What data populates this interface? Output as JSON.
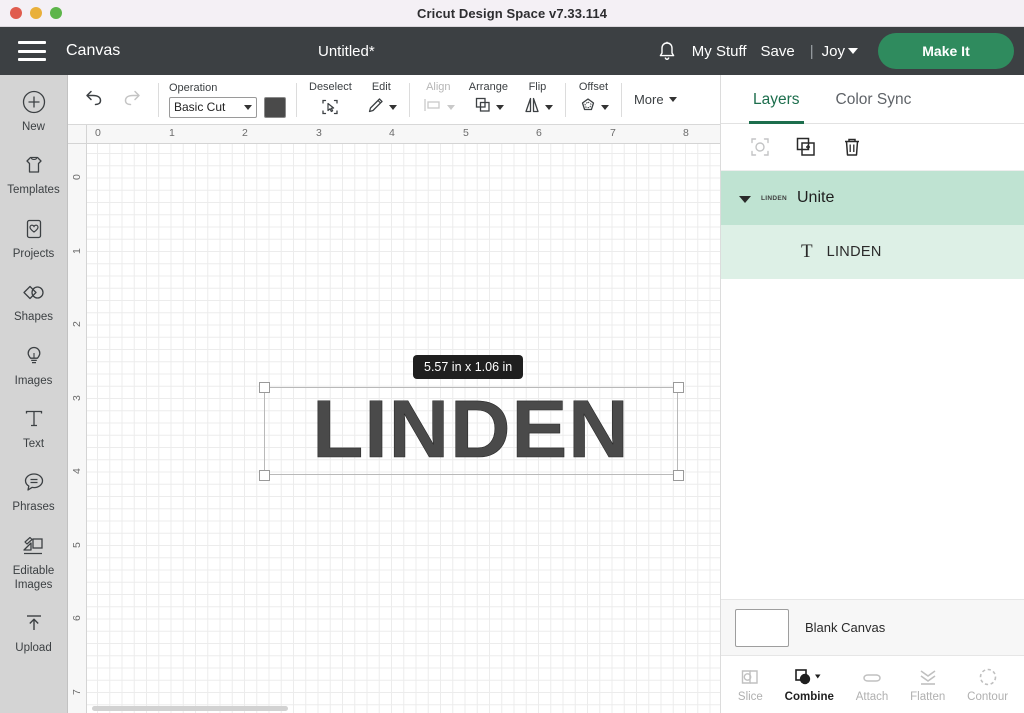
{
  "window": {
    "title": "Cricut Design Space  v7.33.114",
    "traffic_lights": [
      "close",
      "minimize",
      "maximize"
    ]
  },
  "header": {
    "menu_icon": "hamburger-icon",
    "canvas_label": "Canvas",
    "document_title": "Untitled*",
    "bell_icon": "bell-icon",
    "my_stuff": "My Stuff",
    "save": "Save",
    "divider": "|",
    "machine": "Joy",
    "make_it": "Make It",
    "make_it_color": "#2f8b5e"
  },
  "sidebar": {
    "items": [
      {
        "label": "New",
        "icon": "plus-circle-icon"
      },
      {
        "label": "Templates",
        "icon": "tshirt-icon"
      },
      {
        "label": "Projects",
        "icon": "heart-card-icon"
      },
      {
        "label": "Shapes",
        "icon": "shapes-icon"
      },
      {
        "label": "Images",
        "icon": "lightbulb-icon"
      },
      {
        "label": "Text",
        "icon": "text-t-icon"
      },
      {
        "label": "Phrases",
        "icon": "speech-bubble-icon"
      },
      {
        "label": "Editable Images",
        "icon": "editable-images-icon"
      },
      {
        "label": "Upload",
        "icon": "upload-arrow-icon"
      }
    ]
  },
  "toolbar": {
    "undo_icon": "undo-icon",
    "redo_icon": "redo-icon",
    "operation_label": "Operation",
    "operation_value": "Basic Cut",
    "operation_color": "#4a4a4a",
    "groups": [
      {
        "caption": "Deselect",
        "icon": "deselect-icon",
        "disabled": false,
        "has_caret": false
      },
      {
        "caption": "Edit",
        "icon": "pencil-icon",
        "disabled": false,
        "has_caret": true
      },
      {
        "caption": "Align",
        "icon": "align-icon",
        "disabled": true,
        "has_caret": true
      },
      {
        "caption": "Arrange",
        "icon": "arrange-icon",
        "disabled": false,
        "has_caret": true
      },
      {
        "caption": "Flip",
        "icon": "flip-icon",
        "disabled": false,
        "has_caret": true
      },
      {
        "caption": "Offset",
        "icon": "offset-icon",
        "disabled": false,
        "has_caret": true
      }
    ],
    "more_label": "More"
  },
  "canvas": {
    "ruler_h_labels": [
      "0",
      "1",
      "2",
      "3",
      "4",
      "5",
      "6",
      "7",
      "8"
    ],
    "ruler_v_labels": [
      "0",
      "1",
      "2",
      "3",
      "4",
      "5",
      "6",
      "7"
    ],
    "size_badge": "5.57  in x 1.06  in",
    "design_text": "LINDEN",
    "design_color": "#4a4a4a",
    "selected": true
  },
  "right_panel": {
    "tabs": [
      {
        "label": "Layers",
        "active": true
      },
      {
        "label": "Color Sync",
        "active": false
      }
    ],
    "layer_tools": [
      {
        "icon": "group-select-icon",
        "disabled": true
      },
      {
        "icon": "duplicate-icon",
        "disabled": false
      },
      {
        "icon": "delete-icon",
        "disabled": false
      }
    ],
    "layers": [
      {
        "name": "Unite",
        "thumbnail_text": "LINDEN",
        "type": "group",
        "expanded": true
      },
      {
        "name": "LINDEN",
        "icon": "text-t-icon",
        "type": "text"
      }
    ],
    "blank_canvas_label": "Blank Canvas",
    "actions": [
      {
        "label": "Slice",
        "icon": "slice-icon",
        "enabled": false,
        "has_caret": false
      },
      {
        "label": "Combine",
        "icon": "combine-icon",
        "enabled": true,
        "has_caret": true
      },
      {
        "label": "Attach",
        "icon": "attach-icon",
        "enabled": false,
        "has_caret": false
      },
      {
        "label": "Flatten",
        "icon": "flatten-icon",
        "enabled": false,
        "has_caret": false
      },
      {
        "label": "Contour",
        "icon": "contour-icon",
        "enabled": false,
        "has_caret": false
      }
    ]
  }
}
